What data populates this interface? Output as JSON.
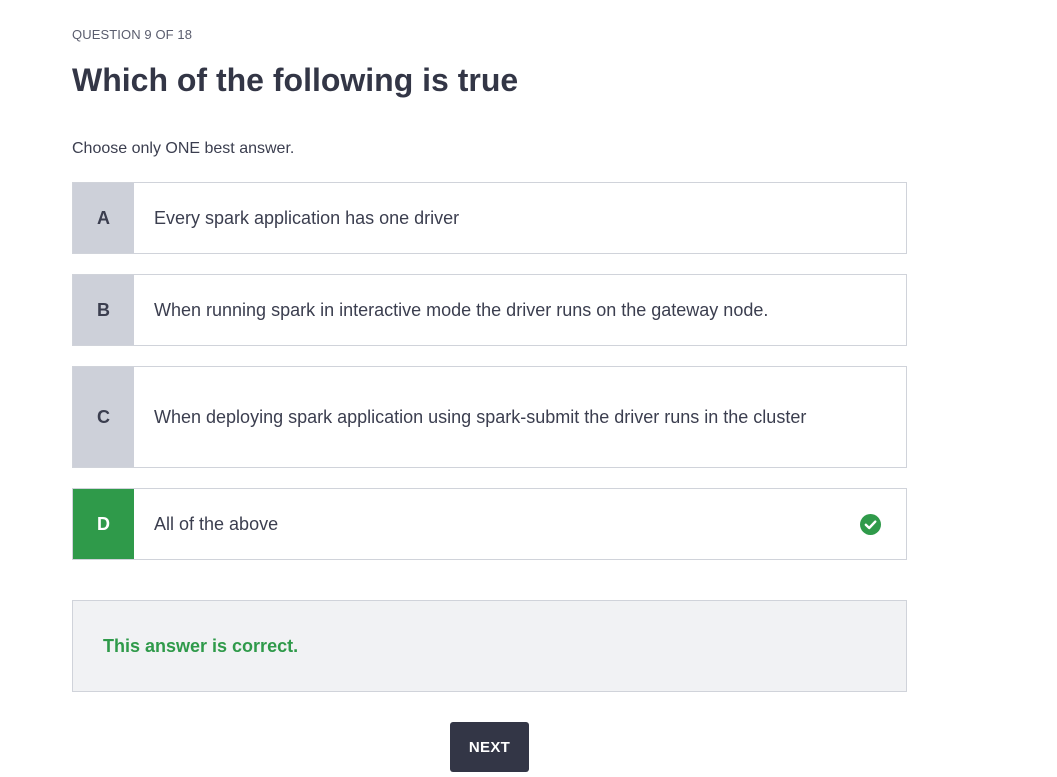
{
  "quiz": {
    "progress": "QUESTION 9 OF 18",
    "question": "Which of the following is true",
    "instructions": "Choose only ONE best answer."
  },
  "options": [
    {
      "letter": "A",
      "text": "Every spark application has one driver",
      "selected": false
    },
    {
      "letter": "B",
      "text": "When running spark in interactive mode the driver runs on the gateway node.",
      "selected": false
    },
    {
      "letter": "C",
      "text": "When deploying spark application using spark-submit the driver runs in the cluster",
      "selected": false
    },
    {
      "letter": "D",
      "text": "All of the above",
      "selected": true,
      "icon": "check-circle-icon"
    }
  ],
  "feedback": {
    "message": "This answer is correct."
  },
  "actions": {
    "next_label": "NEXT"
  },
  "colors": {
    "correct": "#2f9a4a",
    "letter_bg": "#cdd0d9",
    "primary_button": "#333646",
    "feedback_bg": "#f1f2f4"
  }
}
